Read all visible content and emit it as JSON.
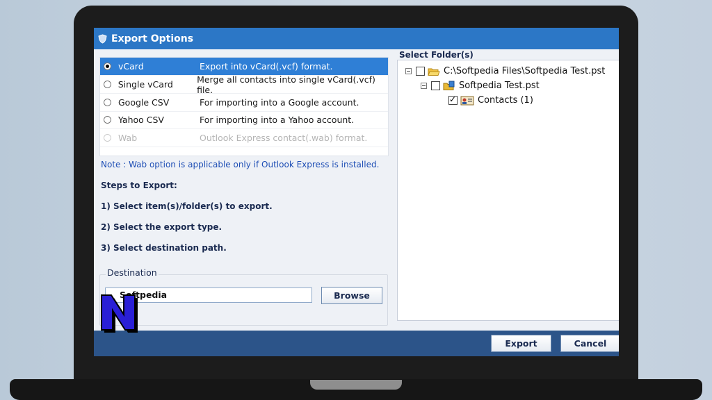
{
  "window": {
    "title": "Export Options",
    "title_icon": "shield-icon"
  },
  "export_options": [
    {
      "name": "vCard",
      "description": "Export into vCard(.vcf) format.",
      "selected": true,
      "enabled": true
    },
    {
      "name": "Single vCard",
      "description": "Merge all contacts into single vCard(.vcf) file.",
      "selected": false,
      "enabled": true
    },
    {
      "name": "Google CSV",
      "description": "For importing into a Google account.",
      "selected": false,
      "enabled": true
    },
    {
      "name": "Yahoo CSV",
      "description": "For importing into a Yahoo account.",
      "selected": false,
      "enabled": true
    },
    {
      "name": "Wab",
      "description": "Outlook Express contact(.wab) format.",
      "selected": false,
      "enabled": false
    }
  ],
  "note": "Note : Wab option is applicable only if Outlook Express is installed.",
  "steps": {
    "heading": "Steps to Export:",
    "items": [
      "1) Select item(s)/folder(s) to export.",
      "2) Select the export type.",
      "3) Select destination path."
    ]
  },
  "destination": {
    "label": "Destination",
    "value": "Softpedia",
    "browse_label": "Browse"
  },
  "folders": {
    "label": "Select Folder(s)",
    "tree": [
      {
        "label": "C:\\Softpedia Files\\Softpedia Test.pst",
        "level": 0,
        "checked": false,
        "icon": "folder-open-icon"
      },
      {
        "label": "Softpedia Test.pst",
        "level": 1,
        "checked": false,
        "icon": "pst-file-icon"
      },
      {
        "label": "Contacts (1)",
        "level": 2,
        "checked": true,
        "icon": "contacts-icon"
      }
    ]
  },
  "footer": {
    "export_label": "Export",
    "cancel_label": "Cancel"
  },
  "colors": {
    "titlebar": "#2c77c6",
    "selection": "#2f7fd6",
    "bottombar": "#2c5489",
    "note": "#1f4fb5"
  },
  "watermark": "N"
}
